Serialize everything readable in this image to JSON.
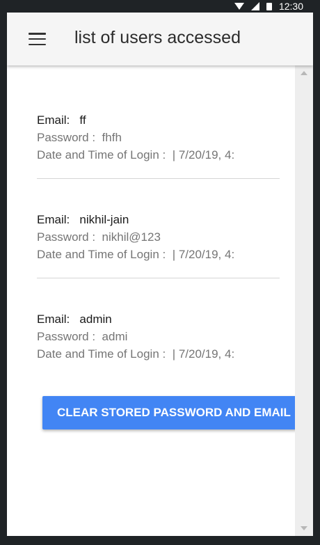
{
  "status_bar": {
    "time": "12:30"
  },
  "app_bar": {
    "title": "list of users accessed"
  },
  "users": [
    {
      "email_label": "Email:",
      "email": "ff",
      "password_label": "Password :",
      "password": "fhfh",
      "date_label": "Date and Time of Login :",
      "date": "|  7/20/19, 4:"
    },
    {
      "email_label": "Email:",
      "email": "nikhil-jain",
      "password_label": "Password :",
      "password": "nikhil@123",
      "date_label": "Date and Time of Login :",
      "date": "|  7/20/19, 4:"
    },
    {
      "email_label": "Email:",
      "email": "admin",
      "password_label": "Password :",
      "password": "admi",
      "date_label": "Date and Time of Login :",
      "date": "|  7/20/19, 4:"
    }
  ],
  "clear_button": {
    "label": "CLEAR STORED PASSWORD AND EMAIL"
  },
  "colors": {
    "accent": "#4285f4",
    "status_bar": "#1f2326",
    "app_bar": "#f5f5f5"
  }
}
